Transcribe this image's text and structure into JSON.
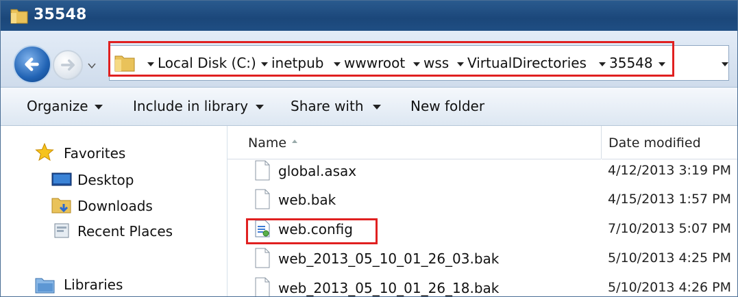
{
  "window": {
    "title": "35548"
  },
  "address_bar": {
    "crumbs": [
      "Local Disk (C:)",
      "inetpub",
      "wwwroot",
      "wss",
      "VirtualDirectories",
      "35548"
    ]
  },
  "toolbar": {
    "organize": "Organize",
    "include_in_library": "Include in library",
    "share_with": "Share with",
    "new_folder": "New folder"
  },
  "nav_pane": {
    "favorites": "Favorites",
    "desktop": "Desktop",
    "downloads": "Downloads",
    "recent_places": "Recent Places",
    "libraries": "Libraries"
  },
  "file_list": {
    "columns": {
      "name": "Name",
      "date_modified": "Date modified"
    },
    "rows": [
      {
        "name": "global.asax",
        "date": "4/12/2013 3:19 PM",
        "icon": "blank-file-icon"
      },
      {
        "name": "web.bak",
        "date": "4/15/2013 1:57 PM",
        "icon": "blank-file-icon"
      },
      {
        "name": "web.config",
        "date": "7/10/2013 5:07 PM",
        "icon": "config-file-icon"
      },
      {
        "name": "web_2013_05_10_01_26_03.bak",
        "date": "5/10/2013 4:25 PM",
        "icon": "blank-file-icon"
      },
      {
        "name": "web_2013_05_10_01_26_18.bak",
        "date": "5/10/2013 4:26 PM",
        "icon": "blank-file-icon"
      }
    ]
  },
  "colors": {
    "highlight": "#e02020",
    "title_bar": "#1f4e83"
  }
}
